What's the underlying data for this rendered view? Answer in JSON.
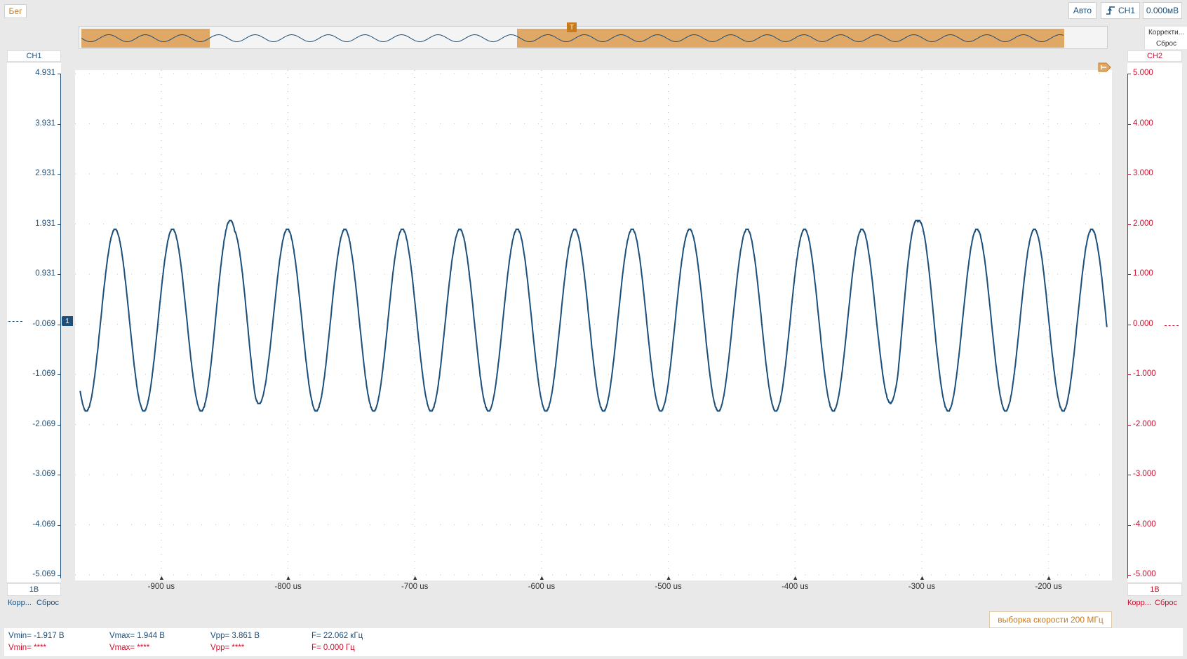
{
  "status": "Бег",
  "toolbar": {
    "mode": "Авто",
    "trigger_channel": "CH1",
    "trigger_level": "0.000мВ"
  },
  "overview": {
    "correct_label": "Корректи...",
    "reset_label": "Сброс",
    "trigger_marker": "T"
  },
  "ch1": {
    "title": "CH1",
    "scale": "1В",
    "footer": "Корр...",
    "reset": "Сброс",
    "marker": "1",
    "ticks": [
      "4.931",
      "3.931",
      "2.931",
      "1.931",
      "0.931",
      "-0.069",
      "-1.069",
      "-2.069",
      "-3.069",
      "-4.069",
      "-5.069"
    ]
  },
  "ch2": {
    "title": "CH2",
    "scale": "1В",
    "footer": "Корр...",
    "reset": "Сброс",
    "ticks": [
      "5.000",
      "4.000",
      "3.000",
      "2.000",
      "1.000",
      "0.000",
      "-1.000",
      "-2.000",
      "-3.000",
      "-4.000",
      "-5.000"
    ]
  },
  "sample_rate": "выборка скорости 200 МГц",
  "x_ticks": [
    "-900 us",
    "-800 us",
    "-700 us",
    "-600 us",
    "-500 us",
    "-400 us",
    "-300 us",
    "-200 us"
  ],
  "measurements": {
    "ch1": {
      "vmin": "Vmin= -1.917 В",
      "vmax": "Vmax= 1.944 В",
      "vpp": "Vpp= 3.861 В",
      "freq": "F= 22.062 кГц"
    },
    "ch2": {
      "vmin": "Vmin= ****",
      "vmax": "Vmax= ****",
      "vpp": "Vpp= ****",
      "freq": "F= 0.000 Гц"
    }
  },
  "colors": {
    "ch1": "#1c4f7a",
    "ch2": "#c8102e",
    "accent": "#e0a866",
    "trigger": "#c77a1f"
  },
  "chart_data": {
    "type": "line",
    "title": "",
    "xlabel": "",
    "ylabel": "",
    "x_range": [
      -968,
      -150
    ],
    "ylim": [
      -5.069,
      4.931
    ],
    "grid": true,
    "series": [
      {
        "name": "CH1",
        "frequency_khz": 22.062,
        "vmin": -1.917,
        "vmax": 1.944,
        "vpp": 3.861
      }
    ],
    "x_tick_values": [
      -900,
      -800,
      -700,
      -600,
      -500,
      -400,
      -300,
      -200
    ]
  }
}
